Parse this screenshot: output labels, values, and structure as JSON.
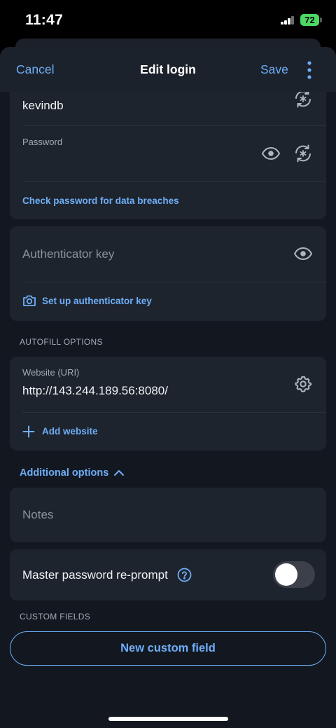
{
  "status_bar": {
    "time": "11:47",
    "battery": "72"
  },
  "nav": {
    "cancel": "Cancel",
    "title": "Edit login",
    "save": "Save"
  },
  "login": {
    "username_value": "kevindb",
    "password_label": "Password",
    "check_breaches_link": "Check password for data breaches"
  },
  "authenticator": {
    "placeholder": "Authenticator key",
    "setup_link": "Set up authenticator key"
  },
  "autofill": {
    "header": "AUTOFILL OPTIONS",
    "website_label": "Website (URI)",
    "website_value": "http://143.244.189.56:8080/",
    "add_website": "Add website"
  },
  "additional": {
    "toggle_label": "Additional options",
    "notes_placeholder": "Notes",
    "reprompt_label": "Master password re-prompt",
    "reprompt_enabled": false
  },
  "custom_fields": {
    "header": "CUSTOM FIELDS",
    "new_button": "New custom field"
  },
  "colors": {
    "accent": "#6eaef8",
    "sheet_background": "#131820",
    "card_background": "#1e242d",
    "battery": "#4cd964"
  },
  "icons": [
    "regenerate-icon",
    "eye-icon",
    "camera-icon",
    "gear-icon",
    "plus-icon",
    "chevron-up-icon",
    "help-circle-icon",
    "more-vertical-icon"
  ]
}
